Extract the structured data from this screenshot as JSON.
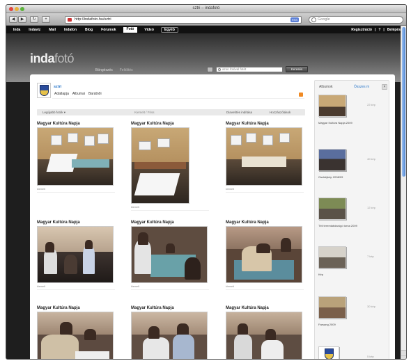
{
  "window": {
    "title": "sztri – indafotó"
  },
  "browser": {
    "back": "◀",
    "forward": "▶",
    "reload": "↻",
    "add": "+",
    "url": "http://indafoto.hu/sztri",
    "rss": "RSS",
    "search_placeholder": "Google"
  },
  "top_nav": {
    "items": [
      "Inda",
      "Indavíz",
      "Mail",
      "Indafon",
      "Blog",
      "Fórumok",
      "Fotó",
      "Videó",
      "Egyéb"
    ],
    "active": "Fotó",
    "right": [
      "Regisztráció",
      "|",
      "?",
      "|",
      "Belépés"
    ]
  },
  "hero": {
    "logo_bold": "inda",
    "logo_thin": "fotó",
    "links": [
      "Böngészés",
      "Feltöltés"
    ],
    "search_placeholder": "azon fotóval fotót",
    "search_button": "Keresés"
  },
  "user": {
    "name": "sztri",
    "tabs": [
      "Adatlapja",
      "Albumai",
      "Barátnői"
    ]
  },
  "filterbar": {
    "sort": "Legújabb fotók ▾",
    "mid": "Kiemelt / Friss",
    "slideshow": "Diavetítés indítása",
    "comments": "Hozzászólások"
  },
  "photos": [
    {
      "title": "Magyar Kultúra Napja",
      "tag": "kiemelt"
    },
    {
      "title": "Magyar Kultúra Napja",
      "tag": "kiemelt"
    },
    {
      "title": "Magyar Kultúra Napja",
      "tag": "kiemelt"
    },
    {
      "title": "Magyar Kultúra Napja",
      "tag": "kiemelt"
    },
    {
      "title": "Magyar Kultúra Napja",
      "tag": "kiemelt"
    },
    {
      "title": "Magyar Kultúra Napja",
      "tag": "kiemelt"
    },
    {
      "title": "Magyar Kultúra Napja",
      "tag": ""
    },
    {
      "title": "Magyar Kultúra Napja",
      "tag": ""
    },
    {
      "title": "Magyar Kultúra Napja",
      "tag": ""
    }
  ],
  "sidebar": {
    "title": "Albumok",
    "link": "Összes m",
    "close": "×",
    "albums": [
      {
        "name": "Magyar Kultúra Napja 2009",
        "count": "22 kép"
      },
      {
        "name": "Osztálykép 2008/09",
        "count": "40 kép"
      },
      {
        "name": "Téli teremlabdarúgó torna 2009",
        "count": "12 kép"
      },
      {
        "name": "Kép",
        "count": "7 kép"
      },
      {
        "name": "Farsang 2009",
        "count": "30 kép"
      },
      {
        "name": "",
        "count": "5 kép"
      }
    ]
  }
}
